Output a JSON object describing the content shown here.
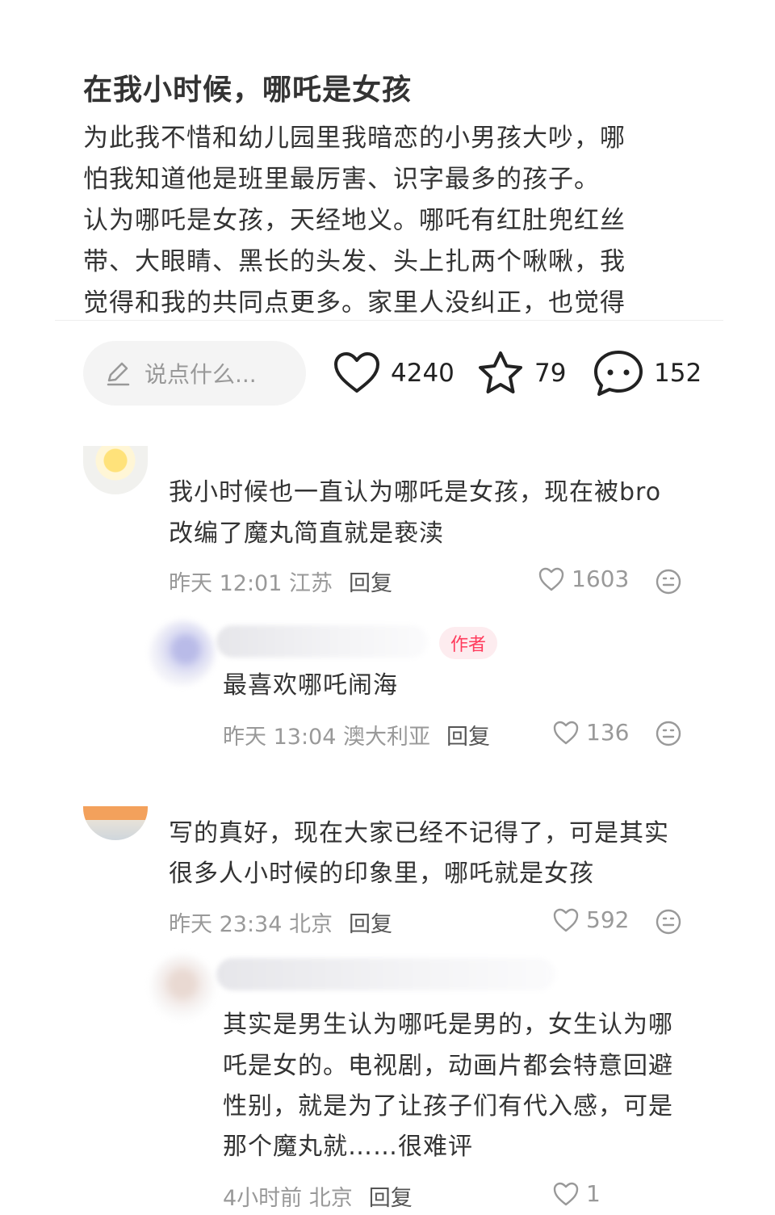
{
  "post": {
    "title": "在我小时候，哪吒是女孩",
    "body_lines": [
      "为此我不惜和幼儿园里我暗恋的小男孩大吵，哪",
      "怕我知道他是班里最厉害、识字最多的孩子。",
      "认为哪吒是女孩，天经地义。哪吒有红肚兜红丝",
      "带、大眼睛、黑长的头发、头上扎两个啾啾，我",
      "觉得和我的共同点更多。家里人没纠正，也觉得"
    ]
  },
  "toolbar": {
    "comment_placeholder": "说点什么...",
    "likes": "4240",
    "favorites": "79",
    "comments": "152"
  },
  "comments": [
    {
      "lines": [
        "我小时候也一直认为哪吒是女孩，现在被bro",
        "改编了魔丸简直就是亵渎"
      ],
      "meta": "昨天 12:01 江苏",
      "reply_label": "回复",
      "likes": "1603",
      "reply": {
        "tag": "作者",
        "lines": [
          "最喜欢哪吒闹海"
        ],
        "meta": "昨天 13:04 澳大利亚",
        "reply_label": "回复",
        "likes": "136"
      }
    },
    {
      "lines": [
        "写的真好，现在大家已经不记得了，可是其实",
        "很多人小时候的印象里，哪吒就是女孩"
      ],
      "meta": "昨天 23:34 北京",
      "reply_label": "回复",
      "likes": "592",
      "reply": {
        "lines": [
          "其实是男生认为哪吒是男的，女生认为哪",
          "吒是女的。电视剧，动画片都会特意回避",
          "性别，就是为了让孩子们有代入感，可是",
          "那个魔丸就……很难评"
        ],
        "meta": "4小时前 北京",
        "reply_label": "回复",
        "likes": "1"
      }
    }
  ],
  "colors": {
    "author_tag": "#ff3b5c",
    "muted": "#999999"
  },
  "icons": [
    "pencil-icon",
    "heart-icon",
    "star-icon",
    "chat-bubble-icon",
    "emoji-icon"
  ]
}
